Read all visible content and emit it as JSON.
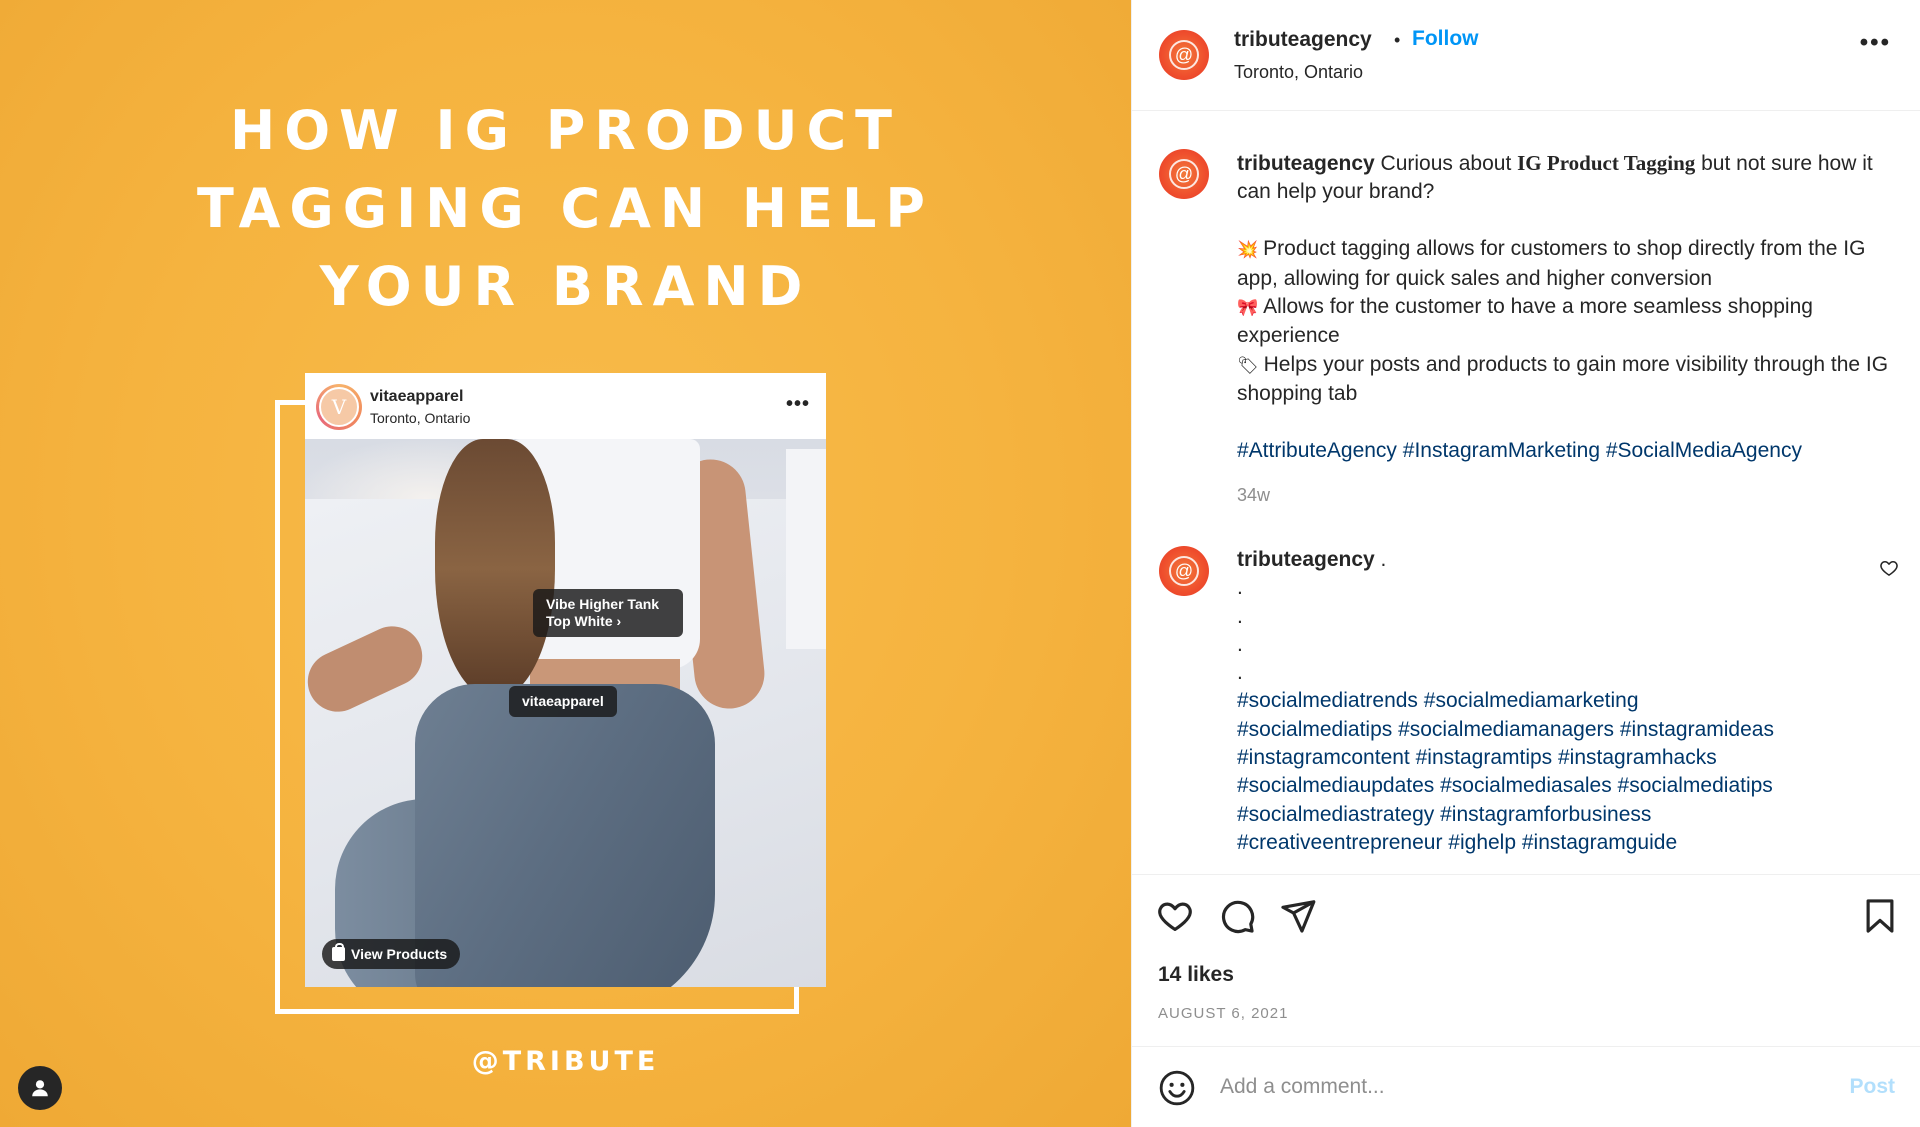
{
  "media": {
    "headline": [
      "HOW IG PRODUCT",
      "TAGGING CAN HELP",
      "YOUR BRAND"
    ],
    "handle": "@TRIBUTE",
    "embedded_post": {
      "avatar_letter": "V",
      "username": "vitaeapparel",
      "location": "Toronto, Ontario",
      "more": "•••",
      "product_tag": "Vibe Higher Tank Top White",
      "product_tag_chevron": "›",
      "brand_tag": "vitaeapparel",
      "view_products": "View Products"
    },
    "background_color": "#f5b33f",
    "user_tag_icon": "person-icon"
  },
  "header": {
    "username": "tributeagency",
    "separator": "•",
    "follow": "Follow",
    "location": "Toronto, Ontario",
    "more": "•••",
    "avatar_glyph": "@"
  },
  "caption": {
    "username": "tributeagency",
    "intro_before": " Curious about ",
    "intro_highlight": "IG Product Tagging",
    "intro_after": " but not sure how it can help your brand?",
    "bullets": [
      {
        "emoji": "💥",
        "text": "Product tagging allows for customers to shop directly from the IG app, allowing for quick sales and higher conversion"
      },
      {
        "emoji": "🎀",
        "text": "Allows for the customer to have a more seamless shopping experience"
      },
      {
        "emoji": "🏷",
        "text": "Helps your posts and products to gain more visibility through the IG shopping tab"
      }
    ],
    "hashtags": "#AttributeAgency #InstagramMarketing #SocialMediaAgency",
    "time": "34w"
  },
  "comment": {
    "username": "tributeagency",
    "first_line": " .",
    "dots": [
      ".",
      ".",
      ".",
      "."
    ],
    "hashtag_lines": [
      "#socialmediatrends #socialmediamarketing",
      "#socialmediatips #socialmediamanagers #instagramideas",
      "#instagramcontent #instagramtips #instagramhacks",
      "#socialmediaupdates #socialmediasales #socialmediatips",
      "#socialmediastrategy #instagramforbusiness",
      "#creativeentrepreneur #ighelp #instagramguide"
    ]
  },
  "footer": {
    "likes": "14 likes",
    "date": "AUGUST 6, 2021",
    "comment_placeholder": "Add a comment...",
    "post_label": "Post"
  },
  "colors": {
    "follow_blue": "#0095f6",
    "hashtag_blue": "#00376b",
    "post_disabled": "#b2dffc",
    "muted_gray": "#8e8e8e"
  }
}
